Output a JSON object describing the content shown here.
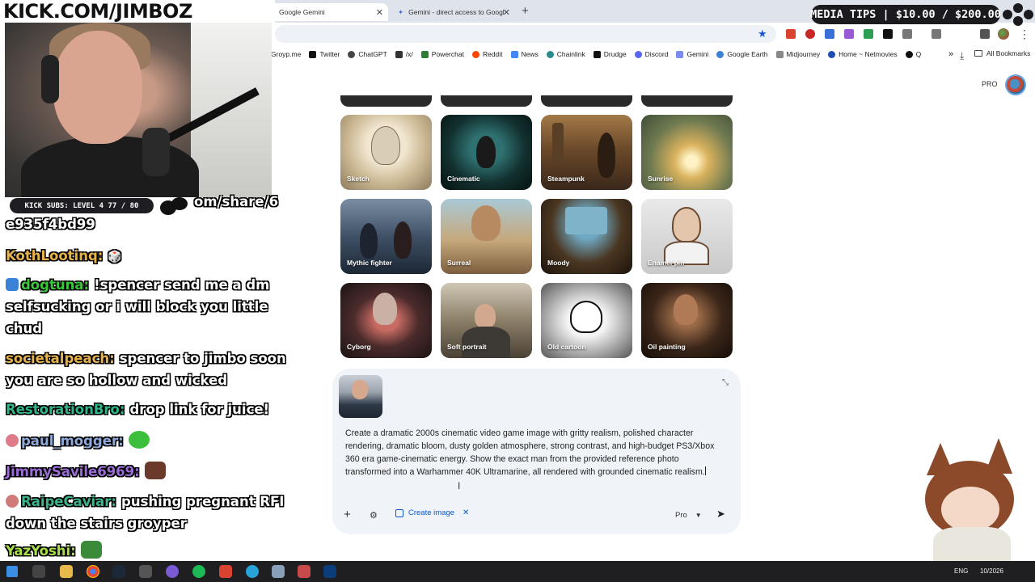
{
  "browser": {
    "tabs": [
      {
        "label": "Google Gemini",
        "active": true
      },
      {
        "label": "Gemini - direct access to Googl",
        "active": false
      }
    ],
    "bookmarks": [
      "Groyp.me",
      "Twitter",
      "ChatGPT",
      "/x/",
      "Powerchat",
      "Reddit",
      "News",
      "Chainlink",
      "Drudge",
      "Discord",
      "Gemini",
      "Google Earth",
      "Midjourney",
      "Home ~ Netmovies",
      "Q"
    ],
    "all_bookmarks_label": "All Bookmarks"
  },
  "gemini": {
    "plan_label": "PRO",
    "styles": [
      "Sketch",
      "Cinematic",
      "Steampunk",
      "Sunrise",
      "Mythic fighter",
      "Surreal",
      "Moody",
      "Enamel pin",
      "Cyborg",
      "Soft portrait",
      "Old cartoon",
      "Oil painting"
    ],
    "prompt": "Create a dramatic 2000s cinematic video game image with gritty realism, polished character rendering, dramatic bloom, dusty golden atmosphere, strong contrast, and high-budget PS3/Xbox 360 era game-cinematic energy. Show the exact man from the provided reference photo transformed into a Warhammer 40K Ultramarine, all rendered with grounded cinematic realism.",
    "create_chip_label": "Create image",
    "model_label": "Pro"
  },
  "overlay": {
    "title": "KICK.COM/JIMBOZ",
    "subs_label": "KICK SUBS: LEVEL 4 77 / 80",
    "media_tips": "MEDIA TIPS | $10.00 / $200.00",
    "chat": [
      {
        "name": "",
        "text": "om/share/6",
        "color": "#ffffff"
      },
      {
        "name": "",
        "text": "e935f4bd99",
        "color": "#ffffff"
      },
      {
        "name": "KothLootinq:",
        "text": "",
        "color": "#e8b24a"
      },
      {
        "name": "dogtuna:",
        "text": "!spencer send me a dm",
        "color": "#38c838"
      },
      {
        "name": "",
        "text": "selfsucking or i will block you little",
        "color": "#ffffff"
      },
      {
        "name": "",
        "text": "chud",
        "color": "#ffffff"
      },
      {
        "name": "societalpeach:",
        "text": "spencer to jimbo soon",
        "color": "#e8b24a"
      },
      {
        "name": "",
        "text": "you are so hollow and wicked",
        "color": "#ffffff"
      },
      {
        "name": "RestorationBro:",
        "text": "drop link for juice!",
        "color": "#2fb58a"
      },
      {
        "name": "paul_mogger:",
        "text": "",
        "color": "#8fa9d8"
      },
      {
        "name": "JimmySavile6969:",
        "text": "",
        "color": "#9b6bd6"
      },
      {
        "name": "RaipeCaviar:",
        "text": "pushing pregnant RFI",
        "color": "#3bb38c"
      },
      {
        "name": "",
        "text": "down the stairs groyper",
        "color": "#ffffff"
      },
      {
        "name": "YazYoshi:",
        "text": "",
        "color": "#a8e04a"
      }
    ]
  },
  "taskbar": {
    "lang": "ENG",
    "date": "10/2026"
  }
}
